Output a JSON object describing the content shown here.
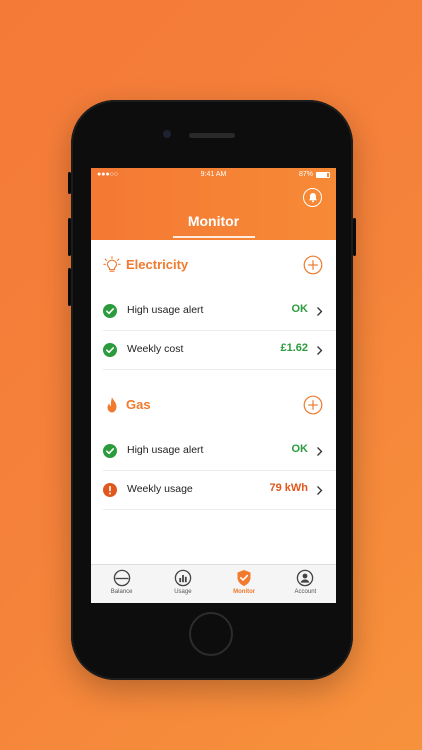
{
  "status_bar": {
    "signal": "●●●○○",
    "time": "9:41 AM",
    "battery": "87%",
    "battery_fraction": 0.87
  },
  "header": {
    "title": "Monitor",
    "bell_icon": "bell-icon"
  },
  "colors": {
    "accent": "#f07a2e",
    "ok": "#2c9b3d",
    "warning": "#e2571e"
  },
  "sections": [
    {
      "title": "Electricity",
      "icon": "lightbulb-icon",
      "rows": [
        {
          "label": "High usage alert",
          "value": "OK",
          "status": "ok"
        },
        {
          "label": "Weekly cost",
          "value": "£1.62",
          "status": "ok"
        }
      ]
    },
    {
      "title": "Gas",
      "icon": "flame-icon",
      "rows": [
        {
          "label": "High usage alert",
          "value": "OK",
          "status": "ok"
        },
        {
          "label": "Weekly usage",
          "value": "79 kWh",
          "status": "warning"
        }
      ]
    }
  ],
  "tabs": [
    {
      "label": "Balance",
      "icon": "gauge-icon"
    },
    {
      "label": "Usage",
      "icon": "bar-chart-icon"
    },
    {
      "label": "Monitor",
      "icon": "shield-check-icon",
      "active": true
    },
    {
      "label": "Account",
      "icon": "user-icon"
    }
  ]
}
